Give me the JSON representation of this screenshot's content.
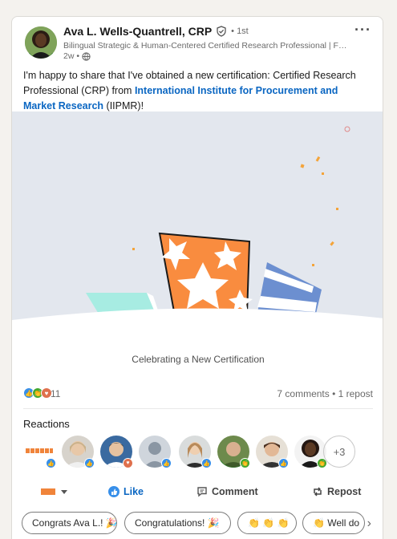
{
  "post": {
    "author_name": "Ava L. Wells-Quantrell, CRP",
    "connection_degree": "• 1st",
    "headline": "Bilingual Strategic & Human-Centered Certified Research Professional | Forma...",
    "time_ago": "2w •",
    "text_before_link": "I'm happy to share that I've obtained a new certification: Certified Research Professional (CRP) from ",
    "link_text": "International Institute for Procurement and Market Research",
    "text_after_link": " (IIPMR)!",
    "graphic_caption": "Celebrating a New Certification",
    "more_icon": "ellipsis-icon",
    "colors": {
      "link": "#0a66c2",
      "orange": "#f98c3f",
      "teal": "#a7ece2",
      "blue": "#6c8fd0"
    }
  },
  "social": {
    "reaction_count": "11",
    "comments_reposts": "7 comments • 1 repost",
    "reactions_title": "Reactions",
    "more_people": "+3"
  },
  "actions": {
    "like": "Like",
    "comment": "Comment",
    "repost": "Repost"
  },
  "chips": [
    "Congrats Ava L.! 🎉",
    "Congratulations! 🎉",
    "👏 👏 👏",
    "👏 Well do"
  ]
}
